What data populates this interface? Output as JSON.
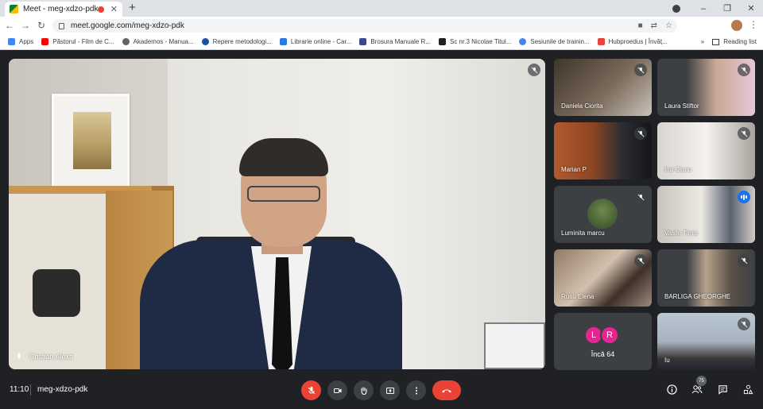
{
  "browser": {
    "tab_title": "Meet - meg-xdzo-pdk",
    "tab_close": "✕",
    "new_tab": "+",
    "url": "meet.google.com/meg-xdzo-pdk",
    "window_controls": [
      "–",
      "❐",
      "✕"
    ]
  },
  "bookmarks": [
    {
      "label": "Apps",
      "color": "#4285f4"
    },
    {
      "label": "Păstorul - Film de C...",
      "color": "#ff0000"
    },
    {
      "label": "Akademos - Manua...",
      "color": "#5f6368"
    },
    {
      "label": "Repere metodologi...",
      "color": "#1a4fa3"
    },
    {
      "label": "Librarie online - Car...",
      "color": "#2c7be5"
    },
    {
      "label": "Brosura Manuale R...",
      "color": "#3a4a8c"
    },
    {
      "label": "Sc nr.3 Nicolae Titul...",
      "color": "#202124"
    },
    {
      "label": "Sesiunile de trainin...",
      "color": "#4285f4"
    },
    {
      "label": "Hubproedus | Învăț...",
      "color": "#e8453c"
    }
  ],
  "bookmarks_more": "»",
  "reading_list": "Reading list",
  "main_speaker": {
    "name": "Cristian Alexa"
  },
  "participants": [
    {
      "name": "Daniela Ciorita",
      "bg": "#5a5046"
    },
    {
      "name": "Laura Stiftor",
      "bg": "#b39a8e"
    },
    {
      "name": "Marian P",
      "bg": "#a0542c"
    },
    {
      "name": "Ina Clanu",
      "bg": "#c9c6c0"
    },
    {
      "name": "Luminita marcu",
      "bg": "#3c4043"
    },
    {
      "name": "Vasile Timis",
      "bg": "#d8d4ce"
    },
    {
      "name": "Rusu Elena",
      "bg": "#b8a08c"
    },
    {
      "name": "BARLIGA GHEORGHE",
      "bg": "#8a7766"
    },
    {
      "name": "Iu",
      "bg": "#b5c3cf"
    }
  ],
  "more_tile": {
    "initials": [
      "L",
      "R"
    ],
    "label": "Încă 64"
  },
  "bottom": {
    "time": "11:10",
    "meeting_code": "meg-xdzo-pdk",
    "participant_count": "75"
  },
  "colors": {
    "accent": "#8ab4f8",
    "danger": "#ea4335",
    "speaking": "#1a73e8"
  }
}
